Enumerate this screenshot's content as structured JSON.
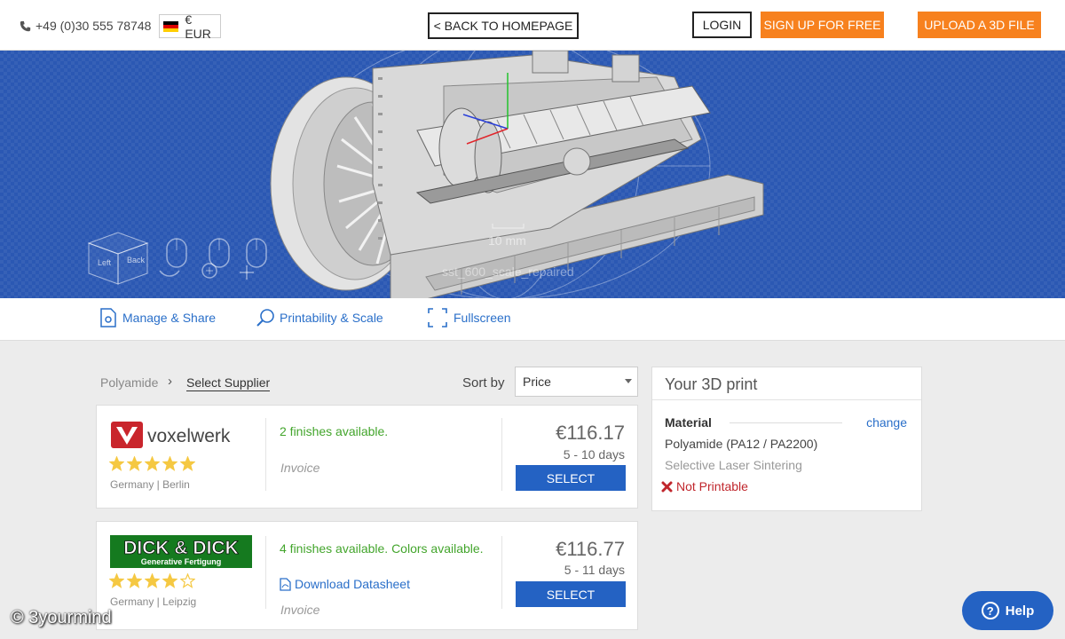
{
  "header": {
    "phone": "+49 (0)30 555 78748",
    "currency": "€ EUR",
    "back_label": "< BACK TO HOMEPAGE",
    "login_label": "LOGIN",
    "signup_label": "SIGN UP FOR FREE",
    "upload_label": "UPLOAD A 3D FILE"
  },
  "viewer": {
    "dimension_label": "10 mm",
    "file_label": "sst_600_scale_repaired",
    "cube_left": "Left",
    "cube_back": "Back"
  },
  "toolbar": {
    "manage_label": "Manage & Share",
    "printability_label": "Printability & Scale",
    "fullscreen_label": "Fullscreen"
  },
  "breadcrumb": {
    "material": "Polyamide",
    "step": "Select Supplier"
  },
  "sort": {
    "label": "Sort by",
    "selected": "Price"
  },
  "suppliers": [
    {
      "name": "voxelwerk",
      "rating": 5,
      "location": "Germany | Berlin",
      "finishes": "2 finishes available.",
      "payment": "Invoice",
      "price": "€116.17",
      "days": "5 - 10 days",
      "select_label": "SELECT"
    },
    {
      "name": "DICK & DICK",
      "subtitle": "Generative Fertigung",
      "rating": 4,
      "location": "Germany | Leipzig",
      "finishes": "4 finishes available. Colors available.",
      "download": "Download Datasheet",
      "payment": "Invoice",
      "price": "€116.77",
      "days": "5 - 11 days",
      "select_label": "SELECT"
    }
  ],
  "print_panel": {
    "title": "Your 3D print",
    "material_label": "Material",
    "change_label": "change",
    "material_name": "Polyamide (PA12 / PA2200)",
    "process": "Selective Laser Sintering",
    "status": "Not Printable"
  },
  "help_label": "Help",
  "watermark": "© 3yourmind",
  "colors": {
    "accent_orange": "#f7811e",
    "select_blue": "#2462c3",
    "link_blue": "#2a6fc9",
    "success_green": "#43a52c",
    "error_red": "#c0262c",
    "viewer_blue": "#2b58b3",
    "star_yellow": "#f5c842"
  }
}
